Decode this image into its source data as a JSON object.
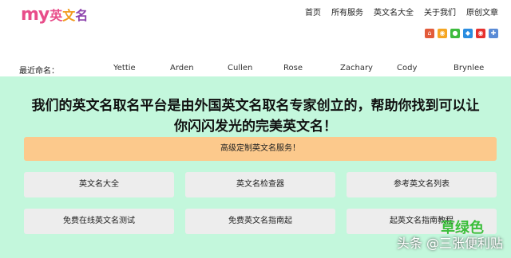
{
  "logo": {
    "latin": "my",
    "cn_1": "英",
    "cn_2": "文",
    "cn_3": "名"
  },
  "nav": [
    "首页",
    "所有服务",
    "英文名大全",
    "关于我们",
    "原创文章"
  ],
  "social_icons": [
    "home-icon",
    "weibo-icon",
    "wechat-icon",
    "qq-icon",
    "weibo-alt-icon",
    "share-icon"
  ],
  "recent": {
    "label": "最近命名：",
    "names": [
      "Yettie",
      "Arden",
      "Cullen",
      "Rose",
      "Zachary",
      "Cody",
      "Brynlee"
    ]
  },
  "headline": {
    "line1": "我们的英文名取名平台是由外国英文名取名专家创立的，帮助你找到可以让",
    "line2": "你闪闪发光的完美英文名！"
  },
  "cta": {
    "label": "高级定制英文名服务！"
  },
  "cards": [
    "英文名大全",
    "英文名检查器",
    "参考英文名列表",
    "免费在线英文名测试",
    "免费英文名指南起",
    "起英文名指南教程"
  ],
  "watermark": {
    "overlay": "草绿色",
    "text": "头条 @三张便利贴"
  },
  "colors": {
    "mint": "#c3f7dc",
    "cta": "#fcc98c",
    "card": "#ededed",
    "brand": "#e84d8a"
  }
}
